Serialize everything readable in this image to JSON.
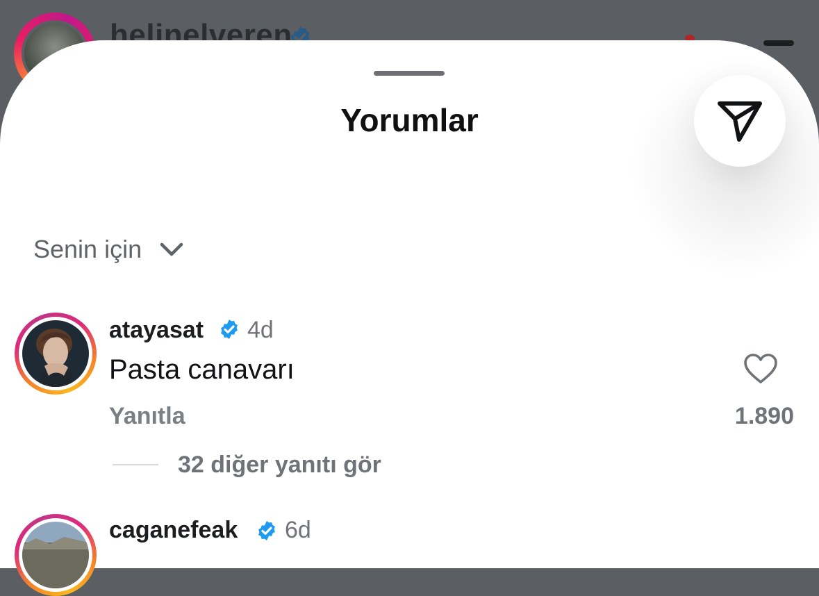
{
  "background": {
    "username": "helinelveren"
  },
  "sheet": {
    "title": "Yorumlar",
    "share_icon": "paper-plane-icon",
    "sort": {
      "label": "Senin için",
      "icon": "chevron-down-icon"
    }
  },
  "comments": [
    {
      "username": "atayasat",
      "verified": true,
      "time": "4d",
      "text": "Pasta canavarı",
      "reply_label": "Yanıtla",
      "likes": "1.890",
      "view_replies": "32 diğer yanıtı gör"
    },
    {
      "username": "caganefeak",
      "verified": true,
      "time": "6d"
    }
  ],
  "colors": {
    "verified_blue": "#1d9bf0",
    "ring_orange": "#f58529",
    "ring_pink": "#dd2a7b",
    "muted_text": "#6f7378"
  }
}
